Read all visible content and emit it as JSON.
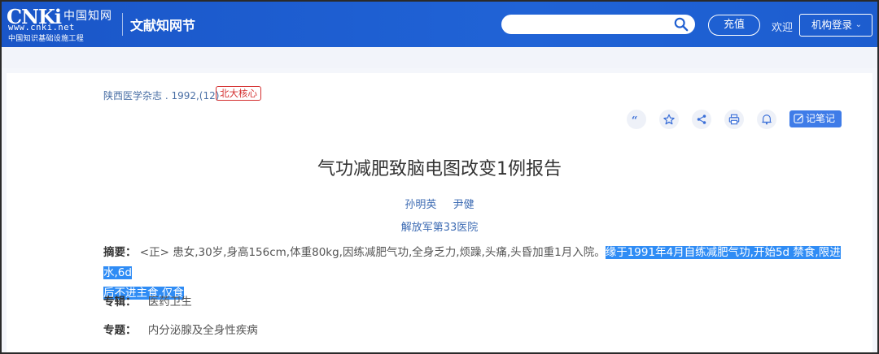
{
  "header": {
    "logo_main": "CNKi",
    "logo_cn": "中国知网",
    "logo_url": "www.cnki.net",
    "logo_sub": "中国知识基础设施工程",
    "brand": "文献知网节",
    "search_placeholder": "",
    "recharge_label": "充值",
    "welcome_text": "欢迎",
    "login_label": "机构登录"
  },
  "article": {
    "journal": "陕西医学杂志 . 1992,(12)",
    "core_badge": "北大核心",
    "note_label": "记笔记",
    "title": "气功减肥致脑电图改变1例报告",
    "authors": [
      "孙明英",
      "尹健"
    ],
    "organization": "解放军第33医院",
    "abstract_label": "摘要：",
    "abstract_plain": "<正> 患女,30岁,身高156cm,体重80kg,因练减肥气功,全身乏力,烦躁,头痛,头昏加重1月入院。",
    "abstract_highlight_1": "缘于1991年4月自练减肥气功,开始5d 禁食,限进水,6d",
    "abstract_highlight_2": "后不进主食,仅食",
    "album_label": "专辑：",
    "album_value": "医药卫生",
    "topic_label": "专题：",
    "topic_value": "内分泌腺及全身性疾病"
  },
  "toolbar_icons": [
    "quote-icon",
    "star-icon",
    "share-icon",
    "print-icon",
    "bell-icon",
    "edit-icon"
  ],
  "colors": {
    "header_bg": "#1f5fd1",
    "highlight": "#2f8cf5",
    "badge": "#d43030",
    "link": "#3d6bb3"
  }
}
